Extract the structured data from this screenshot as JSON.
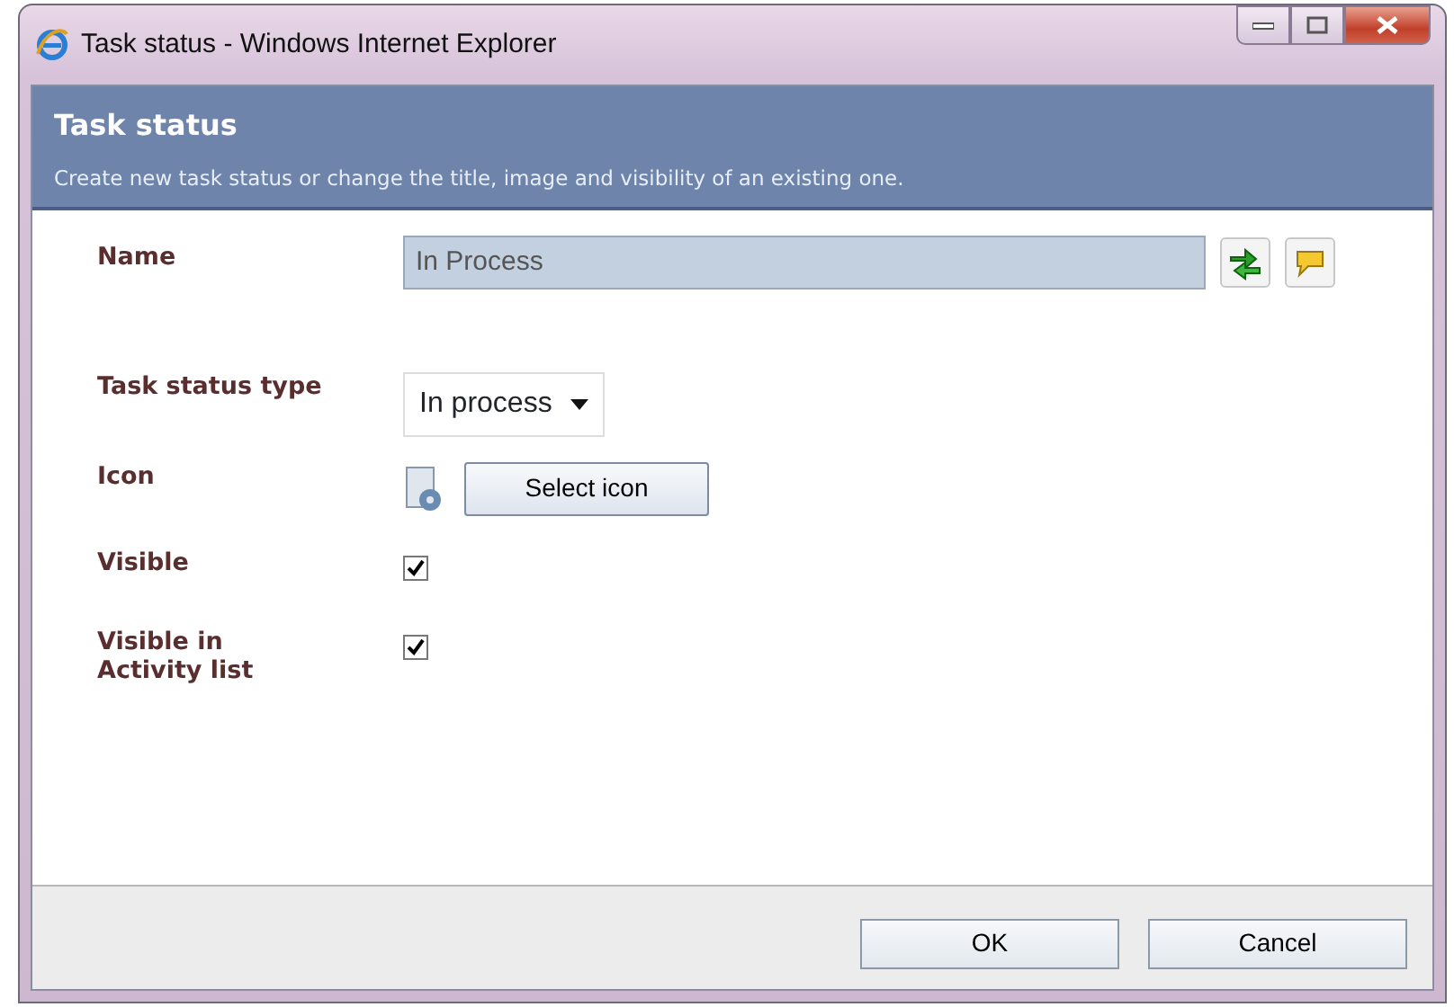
{
  "window": {
    "title": "Task status - Windows Internet Explorer"
  },
  "header": {
    "title": "Task status",
    "description": "Create new task status or change the title, image and visibility of an existing one."
  },
  "fields": [
    {
      "kind": "text",
      "label": "Name",
      "value": "In Process",
      "disabled": true
    },
    {
      "kind": "select",
      "label": "Task status type",
      "value": "In process"
    },
    {
      "kind": "icon",
      "label": "Icon",
      "button": "Select icon"
    },
    {
      "kind": "checkbox",
      "label": "Visible",
      "checked": true
    },
    {
      "kind": "checkbox",
      "label": "Visible in Activity list",
      "checked": true
    }
  ],
  "buttons": [
    "OK",
    "Cancel"
  ]
}
